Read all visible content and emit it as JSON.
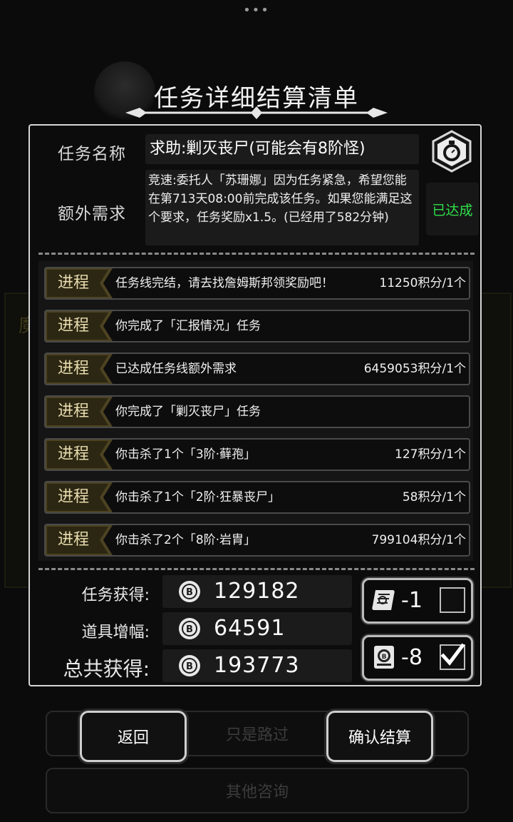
{
  "background": {
    "panel_char": "魔",
    "buttons": [
      "只是路过",
      "其他咨询"
    ]
  },
  "title": "任务详细结算清单",
  "mission": {
    "name_label": "任务名称",
    "name": "求助:剿灭丧尸(可能会有8阶怪)",
    "extra_label": "额外需求",
    "extra_text": "竞速:委托人「苏珊娜」因为任务紧急，希望您能在第713天08:00前完成该任务。如果您能满足这个要求，任务奖励x1.5。(已经用了582分钟)",
    "status": "已达成",
    "status_color": "#2fe04b",
    "badge_icon": "stopwatch-icon"
  },
  "progress_tag": "进程",
  "progress": [
    {
      "text": "任务线完结，请去找詹姆斯邦领奖励吧！",
      "points": "11250积分/1个"
    },
    {
      "text": "你完成了「汇报情况」任务",
      "points": ""
    },
    {
      "text": "已达成任务线额外需求",
      "points": "6459053积分/1个"
    },
    {
      "text": "你完成了「剿灭丧尸」任务",
      "points": ""
    },
    {
      "text": "你击杀了1个「3阶·藓孢」",
      "points": "127积分/1个"
    },
    {
      "text": "你击杀了1个「2阶·狂暴丧尸」",
      "points": "58积分/1个"
    },
    {
      "text": "你击杀了2个「8阶·岩胄」",
      "points": "799104积分/1个"
    }
  ],
  "summary": {
    "task_label": "任务获得:",
    "task_value": "129182",
    "item_label": "道具增幅:",
    "item_value": "64591",
    "total_label": "总共获得:",
    "total_value": "193773",
    "coin_icon": "bitcoin-coin-icon"
  },
  "items": [
    {
      "icon": "scroll-icon",
      "qty": "-1",
      "checked": false
    },
    {
      "icon": "coin-card-icon",
      "qty": "-8",
      "checked": true
    }
  ],
  "buttons": {
    "back": "返回",
    "confirm": "确认结算"
  }
}
